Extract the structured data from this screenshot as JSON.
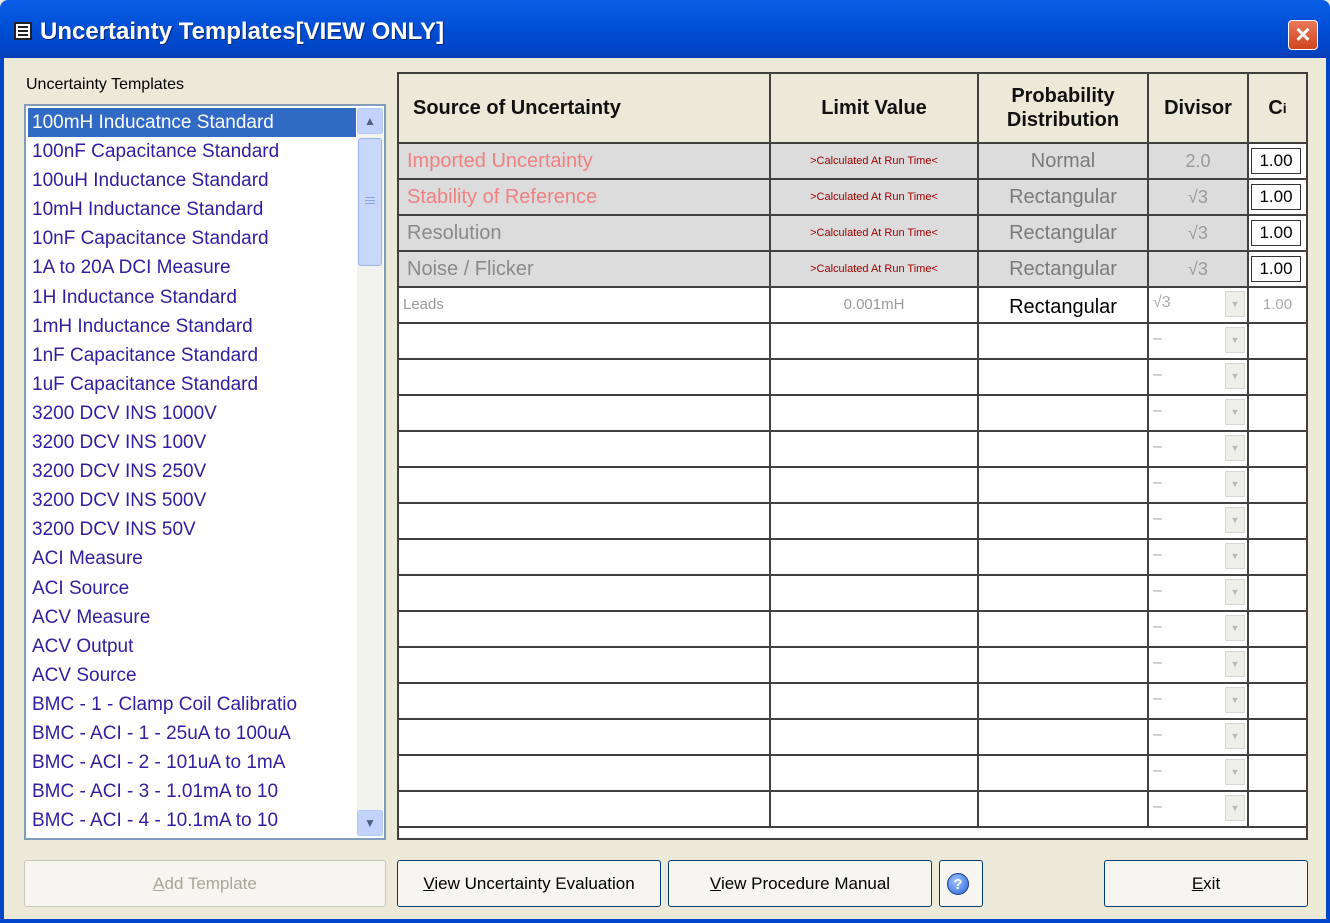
{
  "window": {
    "title": "Uncertainty Templates[VIEW ONLY]",
    "title_icon": "window-list-icon",
    "close_icon": "close-icon"
  },
  "templates": {
    "label": "Uncertainty Templates",
    "selected_index": 0,
    "items": [
      "100mH Inducatnce Standard",
      "100nF Capacitance Standard",
      "100uH Inductance Standard",
      "10mH Inductance Standard",
      "10nF Capacitance Standard",
      "1A to 20A DCI Measure",
      "1H Inductance Standard",
      "1mH Inductance Standard",
      "1nF Capacitance Standard",
      "1uF Capacitance Standard",
      "3200 DCV INS 1000V",
      "3200 DCV INS 100V",
      "3200 DCV INS 250V",
      "3200 DCV INS 500V",
      "3200 DCV INS 50V",
      "ACI Measure",
      "ACI Source",
      "ACV Measure",
      "ACV Output",
      "ACV Source",
      "BMC - 1 - Clamp Coil Calibratio",
      "BMC - ACI - 1 - 25uA  to 100uA",
      "BMC - ACI - 2 - 101uA  to 1mA",
      "BMC - ACI - 3 - 1.01mA  to 10",
      "BMC - ACI - 4 - 10.1mA  to 10"
    ]
  },
  "grid": {
    "headers": {
      "source": "Source of Uncertainty",
      "limit": "Limit Value",
      "distribution": "Probability Distribution",
      "divisor": "Divisor",
      "ci": "C",
      "ci_sub": "i"
    },
    "fixed_rows": [
      {
        "source": "Imported Uncertainty",
        "limit": ">Calculated At Run Time<",
        "distribution": "Normal",
        "divisor": "2.0",
        "ci": "1.00"
      },
      {
        "source": "Stability of Reference",
        "limit": ">Calculated At Run Time<",
        "distribution": "Rectangular",
        "divisor": "√3",
        "ci": "1.00"
      },
      {
        "source": "Resolution",
        "limit": ">Calculated At Run Time<",
        "distribution": "Rectangular",
        "divisor": "√3",
        "ci": "1.00"
      },
      {
        "source": "Noise / Flicker",
        "limit": ">Calculated At Run Time<",
        "distribution": "Rectangular",
        "divisor": "√3",
        "ci": "1.00"
      }
    ],
    "user_rows": [
      {
        "source": "Leads",
        "limit": "0.001mH",
        "distribution": "Rectangular",
        "divisor": "√3",
        "ci": "1.00"
      }
    ],
    "empty_divisor": "–",
    "empty_row_count": 14,
    "colors": {
      "imported_text": "#f08080",
      "normal_text": "#8a8a8a",
      "limit_text": "#a00000"
    }
  },
  "buttons": {
    "add_template": {
      "prefix": "",
      "hot": "A",
      "rest": "dd Template"
    },
    "view_evaluation": {
      "prefix": "",
      "hot": "V",
      "rest": "iew Uncertainty Evaluation"
    },
    "view_manual": {
      "prefix": "",
      "hot": "V",
      "rest": "iew Procedure Manual"
    },
    "help_icon": "help-icon",
    "help_glyph": "?",
    "exit": {
      "prefix": "",
      "hot": "E",
      "rest": "xit"
    }
  }
}
